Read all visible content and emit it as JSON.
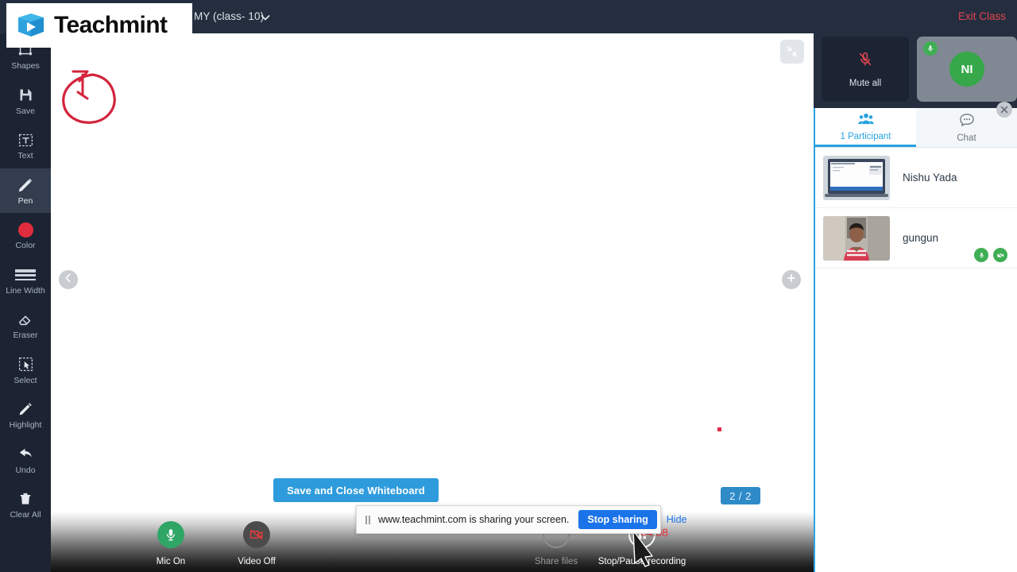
{
  "brand": {
    "name": "Teachmint",
    "logo_icon": "book-play-logo-icon",
    "accent": "#29a3e0"
  },
  "topbar": {
    "class_title": "MY (class- 10)",
    "dropdown_icon": "chevron-down-icon",
    "exit_label": "Exit Class",
    "exit_color": "#e2454f"
  },
  "toolbar": {
    "tools": [
      {
        "label": "Shapes",
        "icon": "shapes-icon",
        "active": false
      },
      {
        "label": "Save",
        "icon": "save-disk-icon",
        "active": false
      },
      {
        "label": "Text",
        "icon": "text-box-icon",
        "active": false
      },
      {
        "label": "Pen",
        "icon": "pen-icon",
        "active": true
      },
      {
        "label": "Color",
        "icon": "color-swatch-icon",
        "active": false,
        "swatch": "#e12c3e"
      },
      {
        "label": "Line Width",
        "icon": "line-width-icon",
        "active": false
      },
      {
        "label": "Eraser",
        "icon": "eraser-icon",
        "active": false
      },
      {
        "label": "Select",
        "icon": "select-marquee-icon",
        "active": false
      },
      {
        "label": "Highlight",
        "icon": "highlighter-icon",
        "active": false
      },
      {
        "label": "Undo",
        "icon": "undo-arrow-icon",
        "active": false
      },
      {
        "label": "Clear All",
        "icon": "trash-icon",
        "active": false
      }
    ]
  },
  "board": {
    "collapse_icon": "collapse-inward-icon",
    "prev_icon": "chevron-left-icon",
    "next_icon": "plus-icon",
    "page_indicator": "2 / 2",
    "ink_color": "#d3243c",
    "save_close_label": "Save and Close Whiteboard"
  },
  "bottom_controls": [
    {
      "label": "Mic On",
      "icon": "microphone-icon",
      "state": "on",
      "dimmed": false
    },
    {
      "label": "Video Off",
      "icon": "camera-off-icon",
      "state": "off",
      "dimmed": false
    },
    {
      "label": "Share files",
      "icon": "share-files-icon",
      "state": "dim",
      "dimmed": true
    },
    {
      "label": "Stop/Pause recording",
      "icon": "pause-recording-icon",
      "state": "recording",
      "dimmed": false
    }
  ],
  "recording": {
    "timer": "04:08",
    "timer_color": "#e8303a"
  },
  "share_banner": {
    "pause_icon": "pause-bars-icon",
    "message": "www.teachmint.com is sharing your screen.",
    "stop_label": "Stop sharing",
    "hide_label": "Hide"
  },
  "right_panel": {
    "mute_all": {
      "label": "Mute all",
      "icon": "mic-muted-icon"
    },
    "self_tile": {
      "initials": "NI",
      "mic_icon": "microphone-icon",
      "avatar_color": "#36a84a"
    },
    "close_icon": "close-icon",
    "tabs": [
      {
        "label": "1 Participant",
        "icon": "participants-icon",
        "active": true
      },
      {
        "label": "Chat",
        "icon": "chat-bubble-icon",
        "active": false
      }
    ],
    "participants": [
      {
        "name": "Nishu Yada",
        "thumb": "screenshare-thumbnail",
        "actions": []
      },
      {
        "name": "gungun",
        "thumb": "webcam-thumbnail",
        "actions": [
          {
            "icon": "microphone-icon",
            "name": "mic-toggle"
          },
          {
            "icon": "camera-off-icon",
            "name": "camera-toggle"
          }
        ]
      }
    ]
  }
}
